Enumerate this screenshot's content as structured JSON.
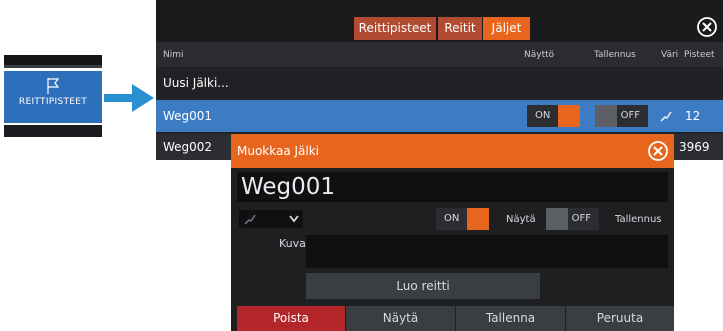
{
  "sidebar_tile": {
    "label": "REITTIPISTEET",
    "icon": "flag-icon"
  },
  "tabs": [
    {
      "label": "Reittipisteet",
      "active": false
    },
    {
      "label": "Reitit",
      "active": false
    },
    {
      "label": "Jäljet",
      "active": true
    }
  ],
  "columns": {
    "name": "Nimi",
    "display": "Näyttö",
    "record": "Tallennus",
    "color": "Väri",
    "points": "Pisteet"
  },
  "rows": [
    {
      "name": "Uusi Jälki..."
    },
    {
      "name": "Weg001",
      "display_toggle": "ON",
      "record_toggle": "OFF",
      "points": "12",
      "selected": true
    },
    {
      "name": "Weg002",
      "points": "3969"
    }
  ],
  "dialog": {
    "title": "Muokkaa Jälki",
    "name_value": "Weg001",
    "display_toggle": "ON",
    "display_label": "Näytä",
    "record_toggle": "OFF",
    "record_label": "Tallennus",
    "description_label": "Kuvaus",
    "description_value": "",
    "create_route_label": "Luo reitti",
    "buttons": {
      "delete": "Poista",
      "show": "Näytä",
      "save": "Tallenna",
      "cancel": "Peruuta"
    }
  },
  "colors": {
    "accent": "#e8651e",
    "selected_row": "#3b7cc4",
    "delete": "#b2262a",
    "tab": "#b14b32"
  }
}
